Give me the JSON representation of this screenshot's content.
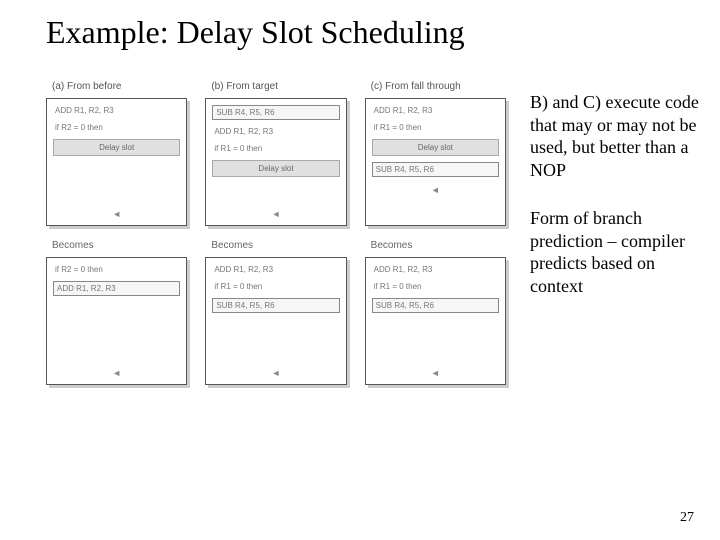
{
  "title": "Example: Delay Slot Scheduling",
  "columns": [
    {
      "label": "(a) From before",
      "top": {
        "lines": [
          "ADD R1, R2, R3",
          "if R2 = 0 then"
        ],
        "slot": "Delay slot"
      },
      "becomes": "Becomes",
      "bottom": {
        "lines": [
          "if R2 = 0 then"
        ],
        "boxed": "ADD R1, R2, R3"
      }
    },
    {
      "label": "(b) From target",
      "top": {
        "lines": [
          "SUB R4, R5, R6",
          "ADD R1, R2, R3",
          "if R1 = 0 then"
        ],
        "slot": "Delay slot"
      },
      "becomes": "Becomes",
      "bottom": {
        "lines": [
          "ADD R1, R2, R3",
          "if R1 = 0 then"
        ],
        "boxed": "SUB R4, R5, R6"
      }
    },
    {
      "label": "(c) From fall through",
      "top": {
        "lines": [
          "ADD R1, R2, R3",
          "if R1 = 0 then"
        ],
        "slot": "Delay slot",
        "after": "SUB R4, R5, R6"
      },
      "becomes": "Becomes",
      "bottom": {
        "lines": [
          "ADD R1, R2, R3",
          "if R1 = 0 then"
        ],
        "boxed": "SUB R4, R5, R6"
      }
    }
  ],
  "side": {
    "p1": "B) and C) execute code that may or may not be used, but better than a NOP",
    "p2": "Form of branch prediction – compiler predicts based on context"
  },
  "arrow": "◄",
  "pagenum": "27"
}
